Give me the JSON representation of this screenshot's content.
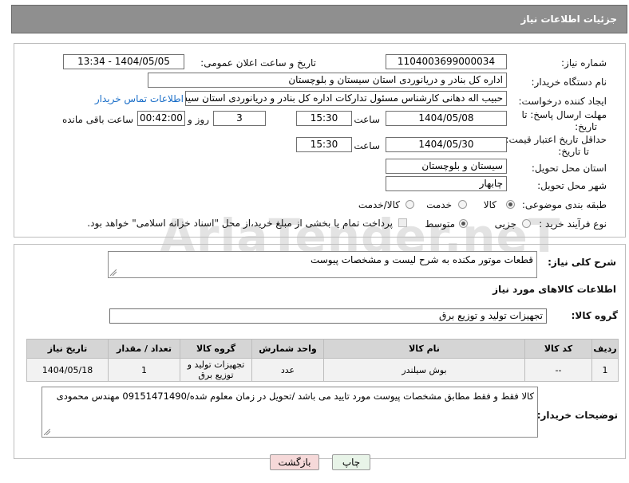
{
  "header": {
    "title": "جزئیات اطلاعات نیاز"
  },
  "watermark": {
    "text": "AriaTender.neT"
  },
  "form": {
    "need_number_label": "شماره نیاز:",
    "need_number": "1104003699000034",
    "announce_label": "تاریخ و ساعت اعلان عمومی:",
    "announce_value": "1404/05/05 - 13:34",
    "buyer_org_label": "نام دستگاه خریدار:",
    "buyer_org": "اداره کل بنادر و دریانوردی استان سیستان و بلوچستان",
    "requester_label": "ایجاد کننده درخواست:",
    "requester": "حبیب اله دهانی کارشناس مسئول تدارکات اداره کل بنادر و دریانوردی استان سیستان",
    "contact_link": "اطلاعات تماس خریدار",
    "deadline_label_1": "مهلت ارسال پاسخ: تا",
    "deadline_label_2": "تاریخ:",
    "deadline_date": "1404/05/08",
    "time_label": "ساعت",
    "deadline_time": "15:30",
    "day_label": "روز و",
    "days_value": "3",
    "remaining_time": "00:42:00",
    "remaining_label": "ساعت باقی مانده",
    "validity_label_1": "حداقل تاریخ اعتبار قیمت:",
    "validity_label_2": "تا تاریخ:",
    "validity_date": "1404/05/30",
    "validity_time": "15:30",
    "province_label": "استان محل تحویل:",
    "province": "سیستان و بلوچستان",
    "city_label": "شهر محل تحویل:",
    "city": "چابهار",
    "category_label": "طبقه بندی موضوعی:",
    "category_options": [
      "کالا",
      "خدمت",
      "کالا/خدمت"
    ],
    "category_selected": "کالا",
    "process_label": "نوع فرآیند خرید :",
    "process_options": [
      "جزیی",
      "متوسط"
    ],
    "process_selected": "متوسط",
    "payment_note": "پرداخت تمام یا بخشی از مبلغ خرید،از محل \"اسناد خزانه اسلامی\" خواهد بود."
  },
  "summary": {
    "label": "شرح کلی نیاز:",
    "value": "قطعات موتور مکنده به شرح لیست و مشخصات پیوست"
  },
  "goods": {
    "section_title": "اطلاعات کالاهای مورد نیاز",
    "group_label": "گروه کالا:",
    "group_value": "تجهیزات تولید و توزیع برق",
    "columns": [
      "ردیف",
      "کد کالا",
      "نام کالا",
      "واحد شمارش",
      "گروه کالا",
      "تعداد / مقدار",
      "تاریخ نیاز"
    ],
    "rows": [
      {
        "row": "1",
        "code": "--",
        "name": "بوش سیلندر",
        "unit": "عدد",
        "group": "تجهیزات تولید و توزیع برق",
        "qty": "1",
        "date": "1404/05/18"
      }
    ]
  },
  "buyer_notes": {
    "label": "توضیحات خریدار:",
    "value": "کالا فقط و فقط مطابق مشخصات پیوست مورد تایید می باشد /تحویل در زمان معلوم شده/09151471490 مهندس محمودی"
  },
  "buttons": {
    "print": "چاپ",
    "back": "بازگشت"
  },
  "colors": {
    "header_bg": "#8f8f8f",
    "link": "#1a6ec8",
    "back_button_bg": "#f6d9d9",
    "print_button_bg": "#e8f4e8"
  }
}
